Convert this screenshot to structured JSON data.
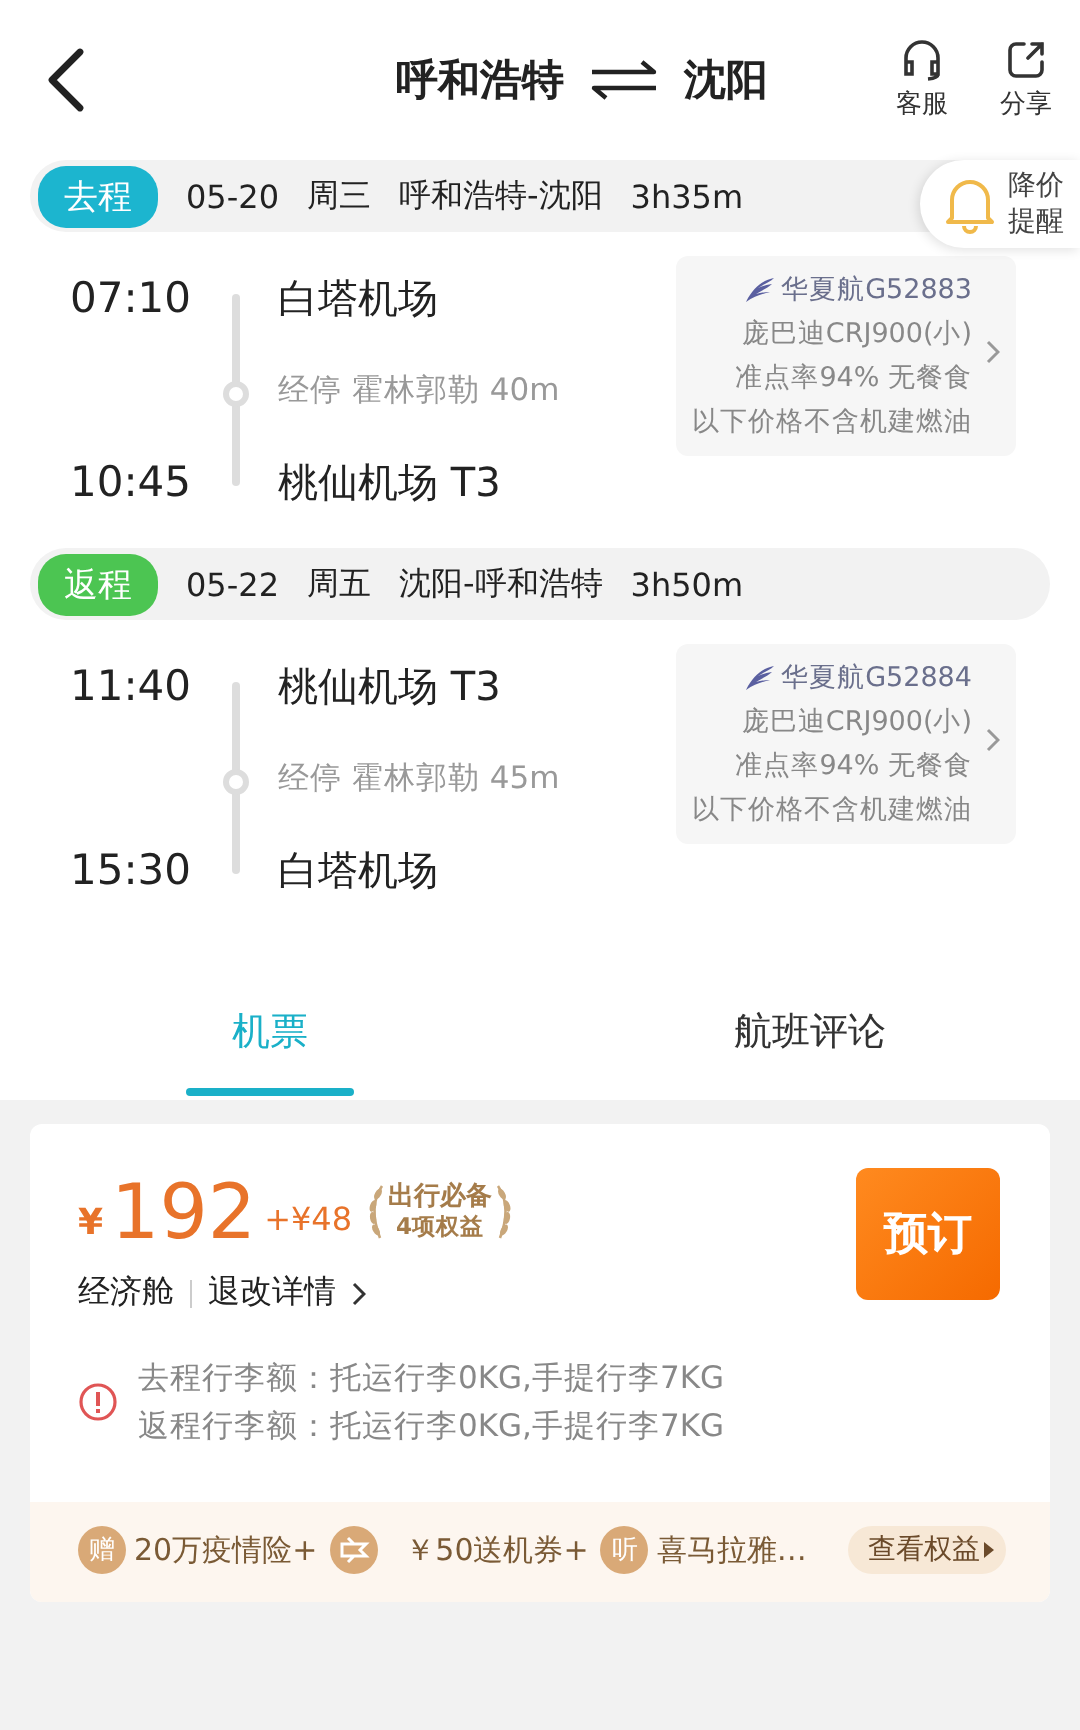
{
  "header": {
    "origin": "呼和浩特",
    "destination": "沈阳",
    "actions": [
      {
        "kind": "headset",
        "label": "客服"
      },
      {
        "kind": "share",
        "label": "分享"
      }
    ]
  },
  "price_alert": {
    "lines": [
      "降价",
      "提醒"
    ]
  },
  "legs": [
    {
      "badge": "去程",
      "color": "#1cb5cf",
      "date": "05-20",
      "weekday": "周三",
      "route": "呼和浩特-沈阳",
      "duration": "3h35m",
      "depart_time": "07:10",
      "depart_airport": "白塔机场",
      "stop": "经停 霍林郭勒 40m",
      "arrive_time": "10:45",
      "arrive_airport": "桃仙机场 T3",
      "airline": "华夏航G52883",
      "aircraft": "庞巴迪CRJ900(小)",
      "punctuality": "准点率94% 无餐食",
      "price_note": "以下价格不含机建燃油"
    },
    {
      "badge": "返程",
      "color": "#4cc552",
      "date": "05-22",
      "weekday": "周五",
      "route": "沈阳-呼和浩特",
      "duration": "3h50m",
      "depart_time": "11:40",
      "depart_airport": "桃仙机场 T3",
      "stop": "经停 霍林郭勒 45m",
      "arrive_time": "15:30",
      "arrive_airport": "白塔机场",
      "airline": "华夏航G52884",
      "aircraft": "庞巴迪CRJ900(小)",
      "punctuality": "准点率94% 无餐食",
      "price_note": "以下价格不含机建燃油"
    }
  ],
  "tabs": [
    {
      "label": "机票",
      "selected": true
    },
    {
      "label": "航班评论",
      "selected": false
    }
  ],
  "fare": {
    "currency": "¥",
    "price": "192",
    "tax": "+¥48",
    "perk_title": "出行必备",
    "perk_count": "4项权益",
    "button": "预订",
    "cabin": "经济舱",
    "refund": "退改详情",
    "baggage": [
      "去程行李额：托运行李0KG,手提行李7KG",
      "返程行李额：托运行李0KG,手提行李7KG"
    ],
    "benefits": [
      {
        "kind": "text",
        "icon_text": "赠",
        "label": "20万疫情险+"
      },
      {
        "kind": "ticket",
        "label": "￥50送机券+"
      },
      {
        "kind": "text",
        "icon_text": "听",
        "label": "喜马拉雅…"
      }
    ],
    "benefits_link": "查看权益"
  }
}
